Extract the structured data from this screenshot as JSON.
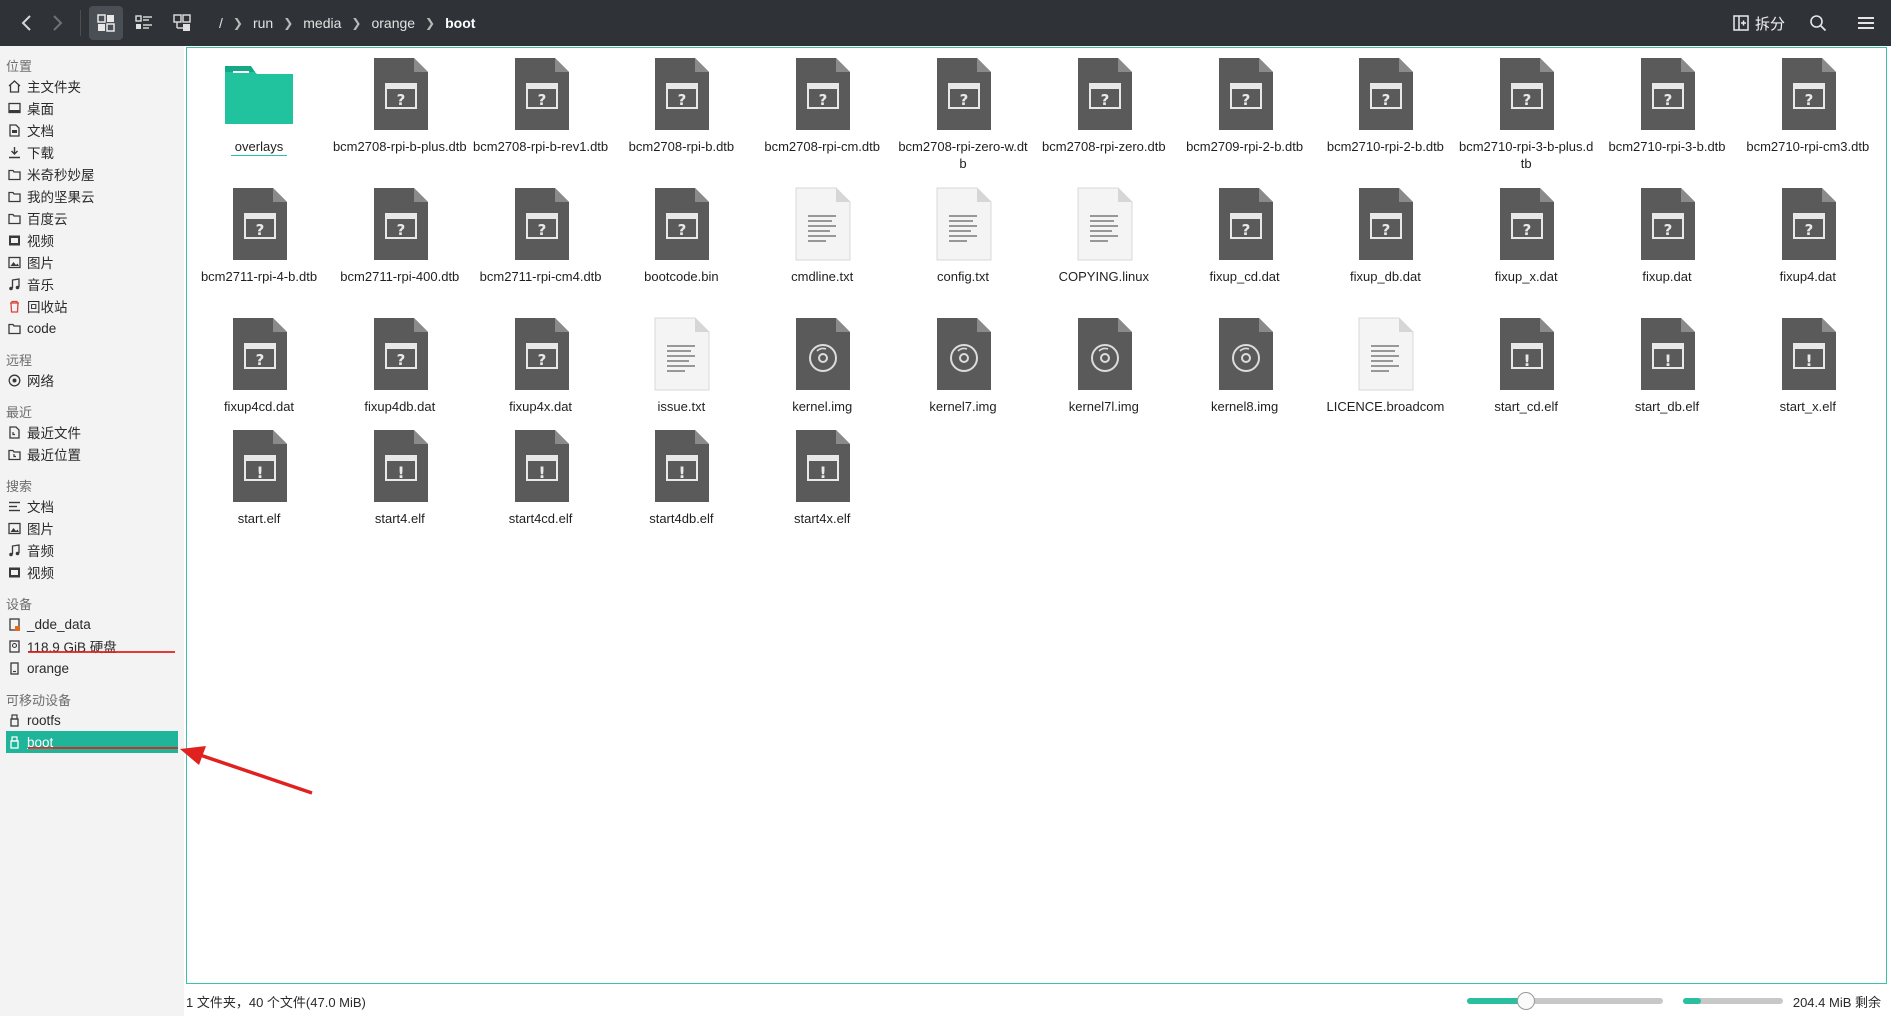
{
  "toolbar": {
    "breadcrumb": [
      "/",
      "run",
      "media",
      "orange",
      "boot"
    ],
    "split_label": "拆分",
    "icons": {
      "back": "chevron-left-icon",
      "forward": "chevron-right-icon",
      "icon_view": "grid-view-icon",
      "detail_view": "list-view-icon",
      "tree_view": "tree-view-icon",
      "search": "search-icon",
      "menu": "hamburger-menu-icon"
    }
  },
  "sidebar": {
    "groups": [
      {
        "title": "位置",
        "items": [
          {
            "label": "主文件夹",
            "icon": "home-icon"
          },
          {
            "label": "桌面",
            "icon": "desktop-icon"
          },
          {
            "label": "文档",
            "icon": "document-icon"
          },
          {
            "label": "下载",
            "icon": "download-icon"
          },
          {
            "label": "米奇秒妙屋",
            "icon": "folder-icon"
          },
          {
            "label": "我的坚果云",
            "icon": "folder-icon"
          },
          {
            "label": "百度云",
            "icon": "folder-icon"
          },
          {
            "label": "视频",
            "icon": "video-icon"
          },
          {
            "label": "图片",
            "icon": "picture-icon"
          },
          {
            "label": "音乐",
            "icon": "music-icon"
          },
          {
            "label": "回收站",
            "icon": "trash-icon"
          },
          {
            "label": "code",
            "icon": "folder-icon"
          }
        ]
      },
      {
        "title": "远程",
        "items": [
          {
            "label": "网络",
            "icon": "network-icon"
          }
        ]
      },
      {
        "title": "最近",
        "items": [
          {
            "label": "最近文件",
            "icon": "recent-files-icon"
          },
          {
            "label": "最近位置",
            "icon": "recent-locations-icon"
          }
        ]
      },
      {
        "title": "搜索",
        "items": [
          {
            "label": "文档",
            "icon": "document-list-icon"
          },
          {
            "label": "图片",
            "icon": "picture-icon"
          },
          {
            "label": "音频",
            "icon": "music-icon"
          },
          {
            "label": "视频",
            "icon": "video-icon"
          }
        ]
      },
      {
        "title": "设备",
        "items": [
          {
            "label": "_dde_data",
            "icon": "drive-icon"
          },
          {
            "label": "118.9 GiB 硬盘",
            "icon": "drive-icon"
          },
          {
            "label": "orange",
            "icon": "drive-icon"
          }
        ]
      },
      {
        "title": "可移动设备",
        "items": [
          {
            "label": "rootfs",
            "icon": "usb-icon"
          },
          {
            "label": "boot",
            "icon": "usb-icon",
            "selected": true
          }
        ]
      }
    ]
  },
  "files": [
    {
      "name": "overlays",
      "type": "folder"
    },
    {
      "name": "bcm2708-rpi-b-plus.dtb",
      "type": "unknown"
    },
    {
      "name": "bcm2708-rpi-b-rev1.dtb",
      "type": "unknown"
    },
    {
      "name": "bcm2708-rpi-b.dtb",
      "type": "unknown"
    },
    {
      "name": "bcm2708-rpi-cm.dtb",
      "type": "unknown"
    },
    {
      "name": "bcm2708-rpi-zero-w.dtb",
      "type": "unknown"
    },
    {
      "name": "bcm2708-rpi-zero.dtb",
      "type": "unknown"
    },
    {
      "name": "bcm2709-rpi-2-b.dtb",
      "type": "unknown"
    },
    {
      "name": "bcm2710-rpi-2-b.dtb",
      "type": "unknown"
    },
    {
      "name": "bcm2710-rpi-3-b-plus.dtb",
      "type": "unknown"
    },
    {
      "name": "bcm2710-rpi-3-b.dtb",
      "type": "unknown"
    },
    {
      "name": "bcm2710-rpi-cm3.dtb",
      "type": "unknown"
    },
    {
      "name": "bcm2711-rpi-4-b.dtb",
      "type": "unknown"
    },
    {
      "name": "bcm2711-rpi-400.dtb",
      "type": "unknown"
    },
    {
      "name": "bcm2711-rpi-cm4.dtb",
      "type": "unknown"
    },
    {
      "name": "bootcode.bin",
      "type": "unknown"
    },
    {
      "name": "cmdline.txt",
      "type": "text"
    },
    {
      "name": "config.txt",
      "type": "text"
    },
    {
      "name": "COPYING.linux",
      "type": "text"
    },
    {
      "name": "fixup_cd.dat",
      "type": "unknown"
    },
    {
      "name": "fixup_db.dat",
      "type": "unknown"
    },
    {
      "name": "fixup_x.dat",
      "type": "unknown"
    },
    {
      "name": "fixup.dat",
      "type": "unknown"
    },
    {
      "name": "fixup4.dat",
      "type": "unknown"
    },
    {
      "name": "fixup4cd.dat",
      "type": "unknown"
    },
    {
      "name": "fixup4db.dat",
      "type": "unknown"
    },
    {
      "name": "fixup4x.dat",
      "type": "unknown"
    },
    {
      "name": "issue.txt",
      "type": "text"
    },
    {
      "name": "kernel.img",
      "type": "disc"
    },
    {
      "name": "kernel7.img",
      "type": "disc"
    },
    {
      "name": "kernel7l.img",
      "type": "disc"
    },
    {
      "name": "kernel8.img",
      "type": "disc"
    },
    {
      "name": "LICENCE.broadcom",
      "type": "text"
    },
    {
      "name": "start_cd.elf",
      "type": "exec"
    },
    {
      "name": "start_db.elf",
      "type": "exec"
    },
    {
      "name": "start_x.elf",
      "type": "exec"
    },
    {
      "name": "start.elf",
      "type": "exec"
    },
    {
      "name": "start4.elf",
      "type": "exec"
    },
    {
      "name": "start4cd.elf",
      "type": "exec"
    },
    {
      "name": "start4db.elf",
      "type": "exec"
    },
    {
      "name": "start4x.elf",
      "type": "exec"
    }
  ],
  "status": {
    "summary": "1 文件夹，40 个文件(47.0 MiB)",
    "zoom_level": 0.3,
    "disk_usage_fraction": 0.18,
    "free_space": "204.4 MiB 剩余"
  },
  "colors": {
    "accent": "#1eb59b",
    "toolbar_bg": "#2f3237",
    "annotation_red": "#e0211f"
  }
}
